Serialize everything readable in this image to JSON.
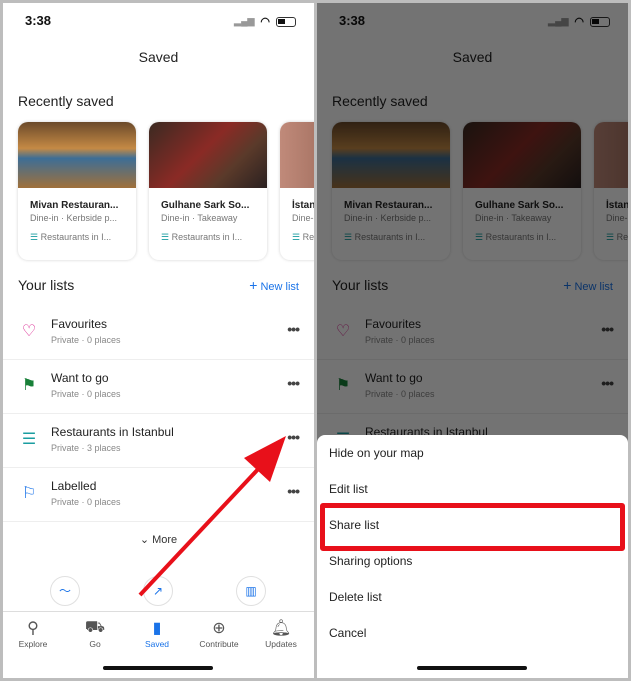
{
  "status": {
    "time": "3:38"
  },
  "header": {
    "title": "Saved"
  },
  "recently_saved": {
    "heading": "Recently saved",
    "cards": [
      {
        "name": "Mivan Restauran...",
        "sub": "Dine-in · Kerbside p...",
        "list": "Restaurants in I..."
      },
      {
        "name": "Gulhane Sark So...",
        "sub": "Dine-in · Takeaway",
        "list": "Restaurants in I..."
      },
      {
        "name": "İstan",
        "sub": "Dine-i",
        "list": "Re"
      }
    ]
  },
  "your_lists": {
    "heading": "Your lists",
    "new_list": "New list",
    "items": [
      {
        "title": "Favourites",
        "sub": "Private · 0 places",
        "icon": "heart-icon",
        "color": "#d81b8c"
      },
      {
        "title": "Want to go",
        "sub": "Private · 0 places",
        "icon": "flag-icon",
        "color": "#188038"
      },
      {
        "title": "Restaurants in Istanbul",
        "sub": "Private · 3 places",
        "icon": "list-icon",
        "color": "#1a9da0"
      },
      {
        "title": "Labelled",
        "sub": "Private · 0 places",
        "icon": "label-flag-icon",
        "color": "#1a73e8"
      }
    ],
    "more": "More"
  },
  "nav": [
    {
      "label": "Explore"
    },
    {
      "label": "Go"
    },
    {
      "label": "Saved"
    },
    {
      "label": "Contribute"
    },
    {
      "label": "Updates"
    }
  ],
  "sheet": {
    "options": [
      "Hide on your map",
      "Edit list",
      "Share list",
      "Sharing options",
      "Delete list",
      "Cancel"
    ],
    "highlighted": "Share list"
  },
  "colors": {
    "accent": "#1a73e8",
    "highlight": "#e8101a"
  }
}
